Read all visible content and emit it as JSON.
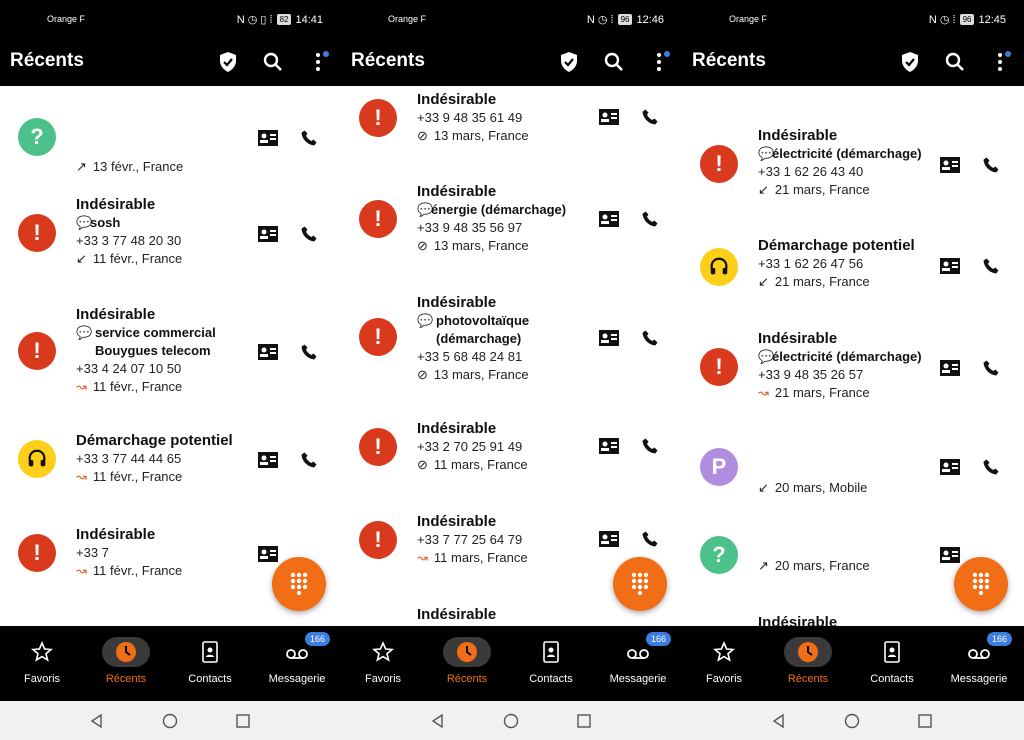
{
  "panels": [
    {
      "status": {
        "carrier": "Orange F",
        "battery": "82",
        "time": "14:41"
      },
      "title": "Récents",
      "rows": [
        {
          "avatar": "?",
          "avatar_color": "green",
          "name": "",
          "tag": "",
          "number": "",
          "meta": "13 févr., France",
          "direction": "outgoing"
        },
        {
          "avatar": "!",
          "avatar_color": "red",
          "name": "Indésirable",
          "tag": "sosh",
          "number": "+33 3 77 48 20 30",
          "meta": "11 févr., France",
          "direction": "incoming"
        },
        {
          "avatar": "!",
          "avatar_color": "red",
          "name": "Indésirable",
          "tag": "service commercial Bouygues telecom",
          "number": "+33 4 24 07 10 50",
          "meta": "11 févr., France",
          "direction": "missed"
        },
        {
          "avatar": "headset",
          "avatar_color": "yellow",
          "name": "Démarchage potentiel",
          "tag": "",
          "number": "+33 3 77 44 44 65",
          "meta": "11 févr., France",
          "direction": "missed"
        },
        {
          "avatar": "!",
          "avatar_color": "red",
          "name": "Indésirable",
          "tag": "",
          "number": "+33 7",
          "meta": "11 févr., France",
          "direction": "missed"
        }
      ]
    },
    {
      "status": {
        "carrier": "Orange F",
        "battery": "96",
        "time": "12:46"
      },
      "title": "Récents",
      "rows": [
        {
          "avatar": "!",
          "avatar_color": "red",
          "name": "Indésirable",
          "tag": "",
          "number": "+33 9 48 35 61 49",
          "meta": "13 mars, France",
          "direction": "blocked"
        },
        {
          "avatar": "!",
          "avatar_color": "red",
          "name": "Indésirable",
          "tag": "énergie (démarchage)",
          "number": "+33 9 48 35 56 97",
          "meta": "13 mars, France",
          "direction": "blocked"
        },
        {
          "avatar": "!",
          "avatar_color": "red",
          "name": "Indésirable",
          "tag": "photovoltaïque (démarchage)",
          "number": "+33 5 68 48 24 81",
          "meta": "13 mars, France",
          "direction": "blocked"
        },
        {
          "avatar": "!",
          "avatar_color": "red",
          "name": "Indésirable",
          "tag": "",
          "number": "+33 2 70 25 91 49",
          "meta": "11 mars, France",
          "direction": "blocked"
        },
        {
          "avatar": "!",
          "avatar_color": "red",
          "name": "Indésirable",
          "tag": "",
          "number": "+33 7 77 25 64 79",
          "meta": "11 mars, France",
          "direction": "missed"
        },
        {
          "avatar": "!",
          "avatar_color": "red",
          "name": "Indésirable",
          "tag": "",
          "number": "",
          "meta": "",
          "direction": ""
        }
      ]
    },
    {
      "status": {
        "carrier": "Orange F",
        "battery": "96",
        "time": "12:45"
      },
      "title": "Récents",
      "rows": [
        {
          "avatar": "!",
          "avatar_color": "red",
          "name": "Indésirable",
          "tag": "électricité (démarchage)",
          "number": "+33 1 62 26 43 40",
          "meta": "21 mars, France",
          "direction": "incoming"
        },
        {
          "avatar": "headset",
          "avatar_color": "yellow",
          "name": "Démarchage potentiel",
          "tag": "",
          "number": "+33 1 62 26 47 56",
          "meta": "21 mars, France",
          "direction": "incoming"
        },
        {
          "avatar": "!",
          "avatar_color": "red",
          "name": "Indésirable",
          "tag": "électricité (démarchage)",
          "number": "+33 9 48 35 26 57",
          "meta": "21 mars, France",
          "direction": "missed"
        },
        {
          "avatar": "P",
          "avatar_color": "purple",
          "name": "",
          "tag": "",
          "number": "",
          "meta": "20 mars, Mobile",
          "direction": "incoming"
        },
        {
          "avatar": "?",
          "avatar_color": "green",
          "name": "",
          "tag": "",
          "number": "",
          "meta": "20 mars, France",
          "direction": "outgoing"
        },
        {
          "avatar": "!",
          "avatar_color": "red",
          "name": "Indésirable",
          "tag": "",
          "number": "",
          "meta": "",
          "direction": ""
        }
      ]
    }
  ],
  "nav": {
    "favoris": "Favoris",
    "recents": "Récents",
    "contacts": "Contacts",
    "messagerie": "Messagerie",
    "badge": "166"
  },
  "colors": {
    "accent": "#f16e16",
    "red": "#d93a1e",
    "green": "#4cc28a",
    "yellow": "#fdcf1a",
    "purple": "#b18de0",
    "badge": "#3b7de0"
  }
}
